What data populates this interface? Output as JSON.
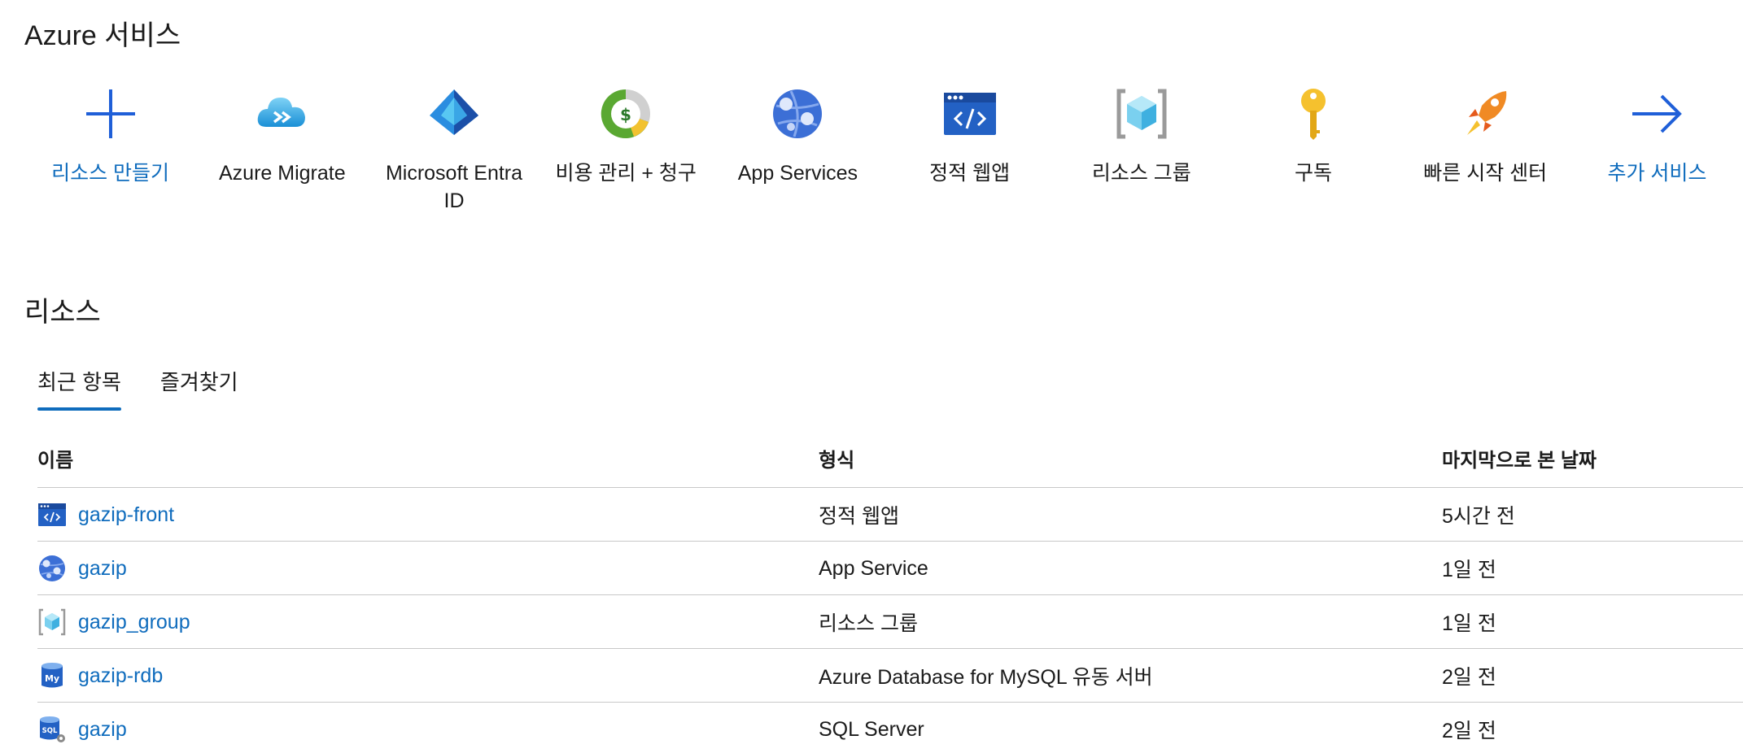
{
  "services_section": {
    "title": "Azure 서비스"
  },
  "services": [
    {
      "label": "리소스 만들기",
      "icon": "plus-icon",
      "link": true
    },
    {
      "label": "Azure Migrate",
      "icon": "azure-migrate-icon",
      "link": false
    },
    {
      "label": "Microsoft Entra ID",
      "icon": "microsoft-entra-id-icon",
      "link": false
    },
    {
      "label": "비용 관리 + 청구",
      "icon": "cost-management-icon",
      "link": false
    },
    {
      "label": "App Services",
      "icon": "app-services-icon",
      "link": false
    },
    {
      "label": "정적 웹앱",
      "icon": "static-web-app-icon",
      "link": false
    },
    {
      "label": "리소스 그룹",
      "icon": "resource-group-icon",
      "link": false
    },
    {
      "label": "구독",
      "icon": "subscription-key-icon",
      "link": false
    },
    {
      "label": "빠른 시작 센터",
      "icon": "quickstart-rocket-icon",
      "link": false
    },
    {
      "label": "추가 서비스",
      "icon": "arrow-right-icon",
      "link": true
    }
  ],
  "resources_section": {
    "title": "리소스"
  },
  "tabs": [
    {
      "label": "최근 항목",
      "active": true
    },
    {
      "label": "즐겨찾기",
      "active": false
    }
  ],
  "table": {
    "headers": {
      "name": "이름",
      "type": "형식",
      "last_viewed": "마지막으로 본 날짜"
    },
    "rows": [
      {
        "name": "gazip-front",
        "type": "정적 웹앱",
        "last_viewed": "5시간 전",
        "icon": "static-web-app-icon"
      },
      {
        "name": "gazip",
        "type": "App Service",
        "last_viewed": "1일 전",
        "icon": "app-services-icon"
      },
      {
        "name": "gazip_group",
        "type": "리소스 그룹",
        "last_viewed": "1일 전",
        "icon": "resource-group-icon"
      },
      {
        "name": "gazip-rdb",
        "type": "Azure Database for MySQL 유동 서버",
        "last_viewed": "2일 전",
        "icon": "mysql-database-icon",
        "icon_text": "My"
      },
      {
        "name": "gazip",
        "type": "SQL Server",
        "last_viewed": "2일 전",
        "icon": "sql-server-icon",
        "icon_text": "SQL"
      }
    ]
  },
  "colors": {
    "link": "#0f6cbd",
    "divider": "#c8c8c8",
    "text": "#1b1b1b"
  }
}
